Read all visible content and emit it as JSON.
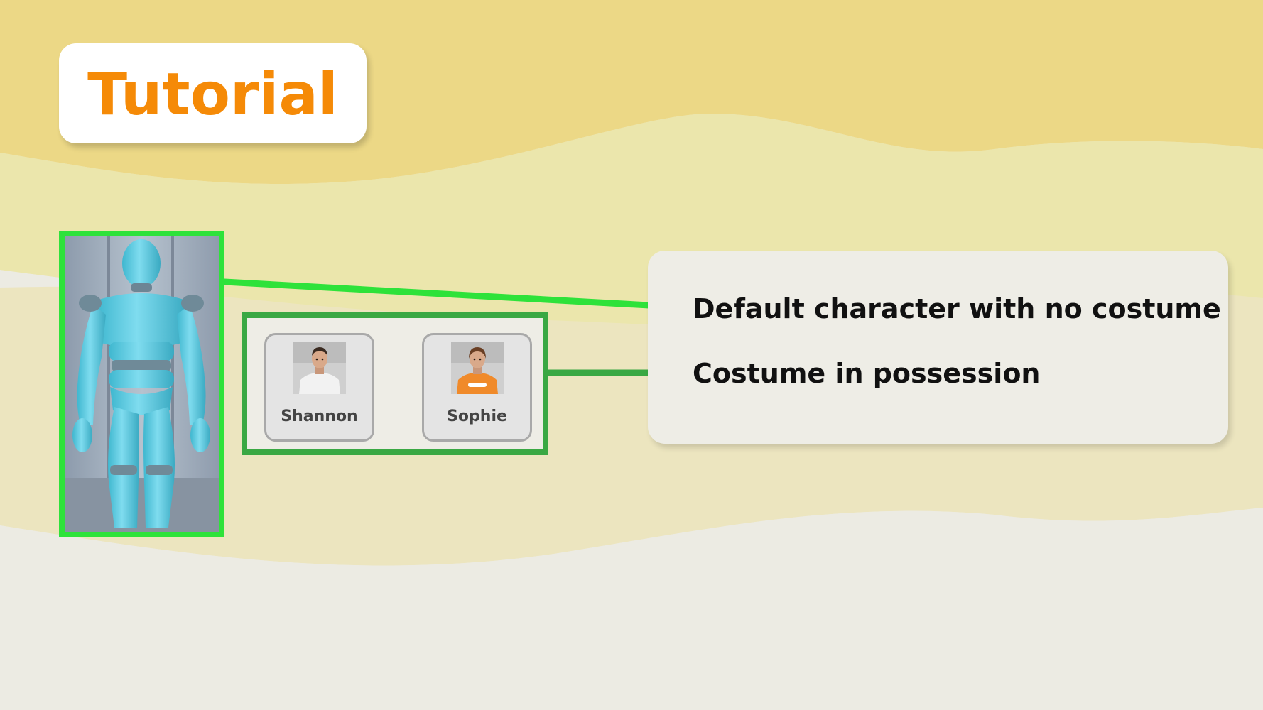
{
  "title": "Tutorial",
  "default_character": {
    "highlight_color": "#2ee23a"
  },
  "costumes": {
    "highlight_color": "#3aa843",
    "items": [
      {
        "name": "Shannon",
        "outfit_color": "#f2f2f2",
        "icon": "avatar-shannon"
      },
      {
        "name": "Sophie",
        "outfit_color": "#f08a2a",
        "icon": "avatar-sophie"
      }
    ]
  },
  "info": {
    "default_character_text": "Default character with no costume",
    "costume_text": "Costume in possession"
  },
  "colors": {
    "title": "#f58a07",
    "background_top": "#ecd886",
    "background_mid": "#ebe6ac",
    "background_bottom": "#ecebe3"
  }
}
